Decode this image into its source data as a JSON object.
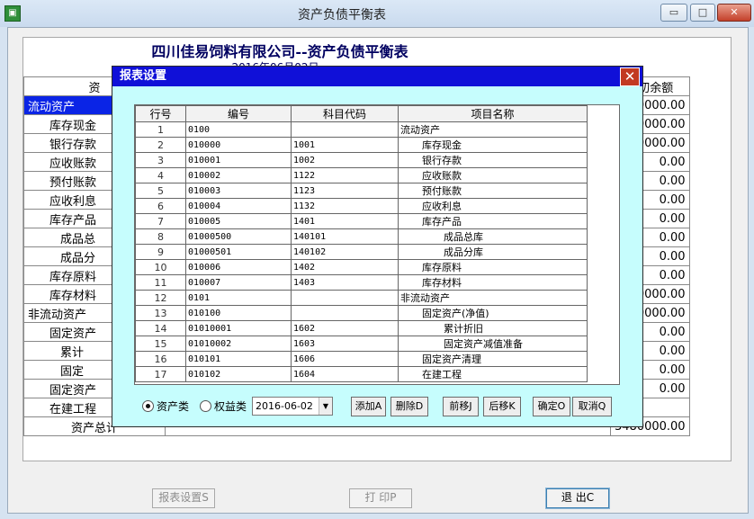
{
  "window": {
    "title": "资产负债平衡表",
    "icon": "app-icon",
    "min": "▭",
    "max": "□",
    "close": "✕"
  },
  "report": {
    "title": "四川佳易饲料有限公司--资产负债平衡表",
    "date": "2016年06月02日",
    "header_item": "资",
    "header_amount": "年初余额",
    "rows": [
      {
        "item": "流动资产",
        "amount": "80000.00"
      },
      {
        "item": "库存现金",
        "amount": "80000.00"
      },
      {
        "item": "银行存款",
        "amount": "80000.00"
      },
      {
        "item": "应收账款",
        "amount": "0.00"
      },
      {
        "item": "预付账款",
        "amount": "0.00"
      },
      {
        "item": "应收利息",
        "amount": "0.00"
      },
      {
        "item": "库存产品",
        "amount": "0.00"
      },
      {
        "item": "成品总",
        "amount": "0.00"
      },
      {
        "item": "成品分",
        "amount": "0.00"
      },
      {
        "item": "库存原料",
        "amount": "0.00"
      },
      {
        "item": "库存材料",
        "amount": "3400000.00"
      },
      {
        "item": "非流动资产",
        "amount": "3400000.00"
      },
      {
        "item": "固定资产",
        "amount": "0.00"
      },
      {
        "item": "累计",
        "amount": "0.00"
      },
      {
        "item": "固定",
        "amount": "0.00"
      },
      {
        "item": "固定资产",
        "amount": "0.00"
      },
      {
        "item": "在建工程",
        "amount": ""
      },
      {
        "item": "资产总计",
        "amount": "3480000.00"
      }
    ]
  },
  "buttons": {
    "report_settings": "报表设置S",
    "print": "打 印P",
    "exit": "退 出C"
  },
  "dialog": {
    "title": "报表设置",
    "close_icon": "✕",
    "columns": [
      "行号",
      "编号",
      "科目代码",
      "项目名称"
    ],
    "rows": [
      {
        "no": "1",
        "code": "0100",
        "acct": "",
        "name": "流动资产",
        "level": 0
      },
      {
        "no": "2",
        "code": "010000",
        "acct": "1001",
        "name": "库存现金",
        "level": 1
      },
      {
        "no": "3",
        "code": "010001",
        "acct": "1002",
        "name": "银行存款",
        "level": 1
      },
      {
        "no": "4",
        "code": "010002",
        "acct": "1122",
        "name": "应收账款",
        "level": 1
      },
      {
        "no": "5",
        "code": "010003",
        "acct": "1123",
        "name": "预付账款",
        "level": 1
      },
      {
        "no": "6",
        "code": "010004",
        "acct": "1132",
        "name": "应收利息",
        "level": 1
      },
      {
        "no": "7",
        "code": "010005",
        "acct": "1401",
        "name": "库存产品",
        "level": 1
      },
      {
        "no": "8",
        "code": "01000500",
        "acct": "140101",
        "name": "成品总库",
        "level": 2
      },
      {
        "no": "9",
        "code": "01000501",
        "acct": "140102",
        "name": "成品分库",
        "level": 2
      },
      {
        "no": "10",
        "code": "010006",
        "acct": "1402",
        "name": "库存原料",
        "level": 1
      },
      {
        "no": "11",
        "code": "010007",
        "acct": "1403",
        "name": "库存材料",
        "level": 1
      },
      {
        "no": "12",
        "code": "0101",
        "acct": "",
        "name": "非流动资产",
        "level": 0
      },
      {
        "no": "13",
        "code": "010100",
        "acct": "",
        "name": "固定资产(净值)",
        "level": 1
      },
      {
        "no": "14",
        "code": "01010001",
        "acct": "1602",
        "name": "累计折旧",
        "level": 2
      },
      {
        "no": "15",
        "code": "01010002",
        "acct": "1603",
        "name": "固定资产减值准备",
        "level": 2
      },
      {
        "no": "16",
        "code": "010101",
        "acct": "1606",
        "name": "固定资产清理",
        "level": 1
      },
      {
        "no": "17",
        "code": "010102",
        "acct": "1604",
        "name": "在建工程",
        "level": 1
      }
    ],
    "radio_assets": "资产类",
    "radio_equity": "权益类",
    "date_value": "2016-06-02",
    "btn_add": "添加A",
    "btn_delete": "删除D",
    "btn_up": "前移J",
    "btn_down": "后移K",
    "btn_ok": "确定O",
    "btn_cancel": "取消Q"
  }
}
